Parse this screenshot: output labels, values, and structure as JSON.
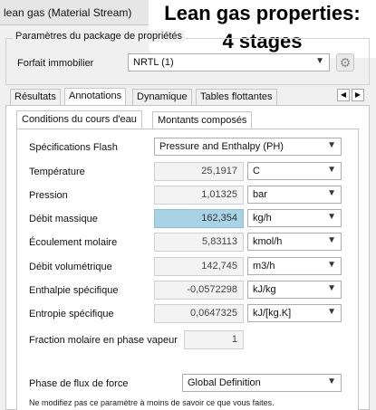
{
  "window": {
    "title": "lean gas (Material Stream)",
    "close_glyph": "×"
  },
  "overlay": {
    "line1": "Lean gas properties:",
    "line2": "4 stages"
  },
  "package_group": {
    "title": "Paramètres du package de propriétés",
    "label": "Forfait immobilier",
    "value": "NRTL (1)"
  },
  "tabs": [
    "Résultats",
    "Annotations",
    "Dynamique",
    "Tables flottantes"
  ],
  "nav": {
    "prev": "◀",
    "next": "▶"
  },
  "subtabs": [
    "Conditions du cours d'eau",
    "Montants composés"
  ],
  "flash": {
    "label": "Spécifications Flash",
    "value": "Pressure and Enthalpy (PH)"
  },
  "properties": [
    {
      "label": "Température",
      "value": "25,1917",
      "unit": "C"
    },
    {
      "label": "Pression",
      "value": "1,01325",
      "unit": "bar"
    },
    {
      "label": "Débit massique",
      "value": "162,354",
      "unit": "kg/h"
    },
    {
      "label": "Écoulement molaire",
      "value": "5,83113",
      "unit": "kmol/h"
    },
    {
      "label": "Débit volumétrique",
      "value": "142,745",
      "unit": "m3/h"
    },
    {
      "label": "Enthalpie spécifique",
      "value": "-0,0572298",
      "unit": "kJ/kg"
    },
    {
      "label": "Entropie spécifique",
      "value": "0,0647325",
      "unit": "kJ/[kg.K]"
    }
  ],
  "vapor_fraction": {
    "label": "Fraction molaire en phase vapeur",
    "value": "1"
  },
  "force_flow": {
    "label": "Phase de flux de force",
    "value": "Global Definition"
  },
  "note": "Ne modifiez pas ce paramètre à moins de savoir ce que vous faites.",
  "icons": {
    "gear": "gear-icon",
    "dropdown": "chevron-down-icon"
  },
  "colors": {
    "selected_field": "#a8d2e6"
  }
}
